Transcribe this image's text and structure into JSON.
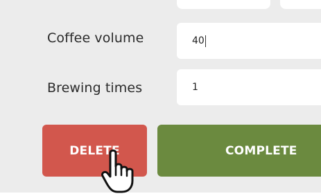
{
  "form": {
    "coffee_volume": {
      "label": "Coffee volume",
      "value": "40"
    },
    "brewing_times": {
      "label": "Brewing times",
      "value": "1"
    }
  },
  "actions": {
    "delete_label": "DELETE",
    "complete_label": "COMPLETE"
  },
  "colors": {
    "panel_background": "#ececec",
    "delete_button": "#d2574d",
    "complete_button": "#6b8a3f"
  },
  "icons": {
    "cursor": "hand-pointer-icon"
  }
}
